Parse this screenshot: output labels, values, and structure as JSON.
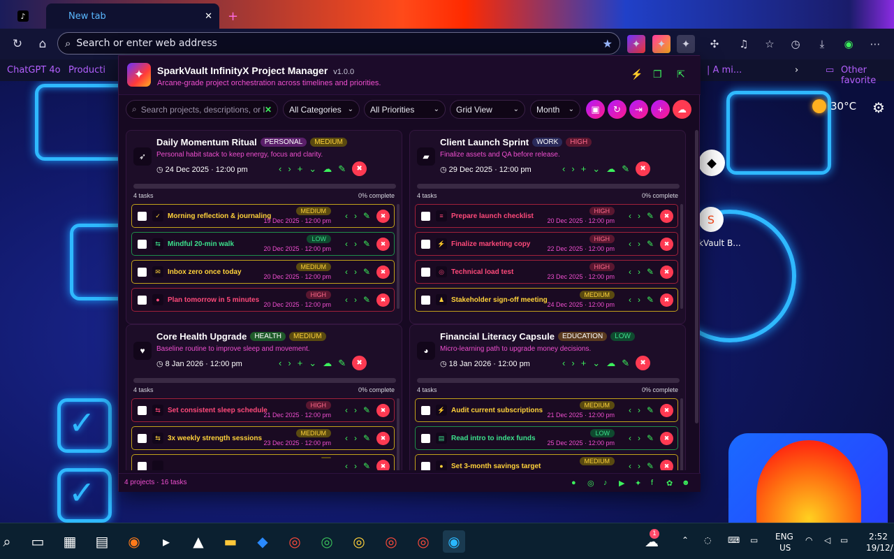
{
  "browser": {
    "tabs": [
      {
        "label": ""
      },
      {
        "label": "New tab"
      }
    ],
    "address_placeholder": "Search or enter web address",
    "favorites": [
      "ChatGPT 4o",
      "Producti",
      "| A mi...",
      "Other favorite"
    ]
  },
  "desktop": {
    "weather_temp": "30°C",
    "icon_label": "kVault B...",
    "taskbar_clock": "2:52",
    "taskbar_date": "19/12/",
    "lang": "ENG",
    "region": "US",
    "notif_count": "1"
  },
  "app": {
    "name": "SparkVault InfinityX Project Manager",
    "version": "v1.0.0",
    "subtitle": "Arcane-grade project orchestration across timelines and priorities.",
    "search_placeholder": "Search projects, descriptions, or la",
    "filters": {
      "category": "All Categories",
      "priority": "All Priorities",
      "view": "Grid View",
      "range": "Month"
    },
    "footer": "4 projects · 16 tasks"
  },
  "projects": [
    {
      "title": "Daily Momentum Ritual",
      "category": "PERSONAL",
      "priority": "MEDIUM",
      "description": "Personal habit stack to keep energy, focus and clarity.",
      "date": "24 Dec 2025 · 12:00 pm",
      "task_count": "4 tasks",
      "completion": "0% complete",
      "icon": "rocket-icon",
      "tasks": [
        {
          "name": "Morning reflection & journaling",
          "priority": "MEDIUM",
          "date": "19 Dec 2025 · 12:00 pm",
          "icon": "✓"
        },
        {
          "name": "Mindful 20-min walk",
          "priority": "LOW",
          "date": "20 Dec 2025 · 12:00 pm",
          "icon": "⇆"
        },
        {
          "name": "Inbox zero once today",
          "priority": "MEDIUM",
          "date": "20 Dec 2025 · 12:00 pm",
          "icon": "✉"
        },
        {
          "name": "Plan tomorrow in 5 minutes",
          "priority": "HIGH",
          "date": "20 Dec 2025 · 12:00 pm",
          "icon": "●"
        }
      ]
    },
    {
      "title": "Client Launch Sprint",
      "category": "WORK",
      "priority": "HIGH",
      "description": "Finalize assets and QA before release.",
      "date": "29 Dec 2025 · 12:00 pm",
      "task_count": "4 tasks",
      "completion": "0% complete",
      "icon": "briefcase-icon",
      "tasks": [
        {
          "name": "Prepare launch checklist",
          "priority": "HIGH",
          "date": "20 Dec 2025 · 12:00 pm",
          "icon": "≡"
        },
        {
          "name": "Finalize marketing copy",
          "priority": "HIGH",
          "date": "22 Dec 2025 · 12:00 pm",
          "icon": "⚡"
        },
        {
          "name": "Technical load test",
          "priority": "HIGH",
          "date": "23 Dec 2025 · 12:00 pm",
          "icon": "◎"
        },
        {
          "name": "Stakeholder sign-off meeting",
          "priority": "MEDIUM",
          "date": "24 Dec 2025 · 12:00 pm",
          "icon": "♟"
        }
      ]
    },
    {
      "title": "Core Health Upgrade",
      "category": "HEALTH",
      "priority": "MEDIUM",
      "description": "Baseline routine to improve sleep and movement.",
      "date": "8 Jan 2026 · 12:00 pm",
      "task_count": "4 tasks",
      "completion": "0% complete",
      "icon": "heart-icon",
      "tasks": [
        {
          "name": "Set consistent sleep schedule",
          "priority": "HIGH",
          "date": "21 Dec 2025 · 12:00 pm",
          "icon": "⇆"
        },
        {
          "name": "3x weekly strength sessions",
          "priority": "MEDIUM",
          "date": "23 Dec 2025 · 12:00 pm",
          "icon": "⇆"
        },
        {
          "name": "",
          "priority": "",
          "date": "",
          "icon": ""
        }
      ]
    },
    {
      "title": "Financial Literacy Capsule",
      "category": "EDUCATION",
      "priority": "LOW",
      "description": "Micro-learning path to upgrade money decisions.",
      "date": "18 Jan 2026 · 12:00 pm",
      "task_count": "4 tasks",
      "completion": "0% complete",
      "icon": "piggy-bank-icon",
      "tasks": [
        {
          "name": "Audit current subscriptions",
          "priority": "MEDIUM",
          "date": "21 Dec 2025 · 12:00 pm",
          "icon": "⚡"
        },
        {
          "name": "Read intro to index funds",
          "priority": "LOW",
          "date": "25 Dec 2025 · 12:00 pm",
          "icon": "▤"
        },
        {
          "name": "Set 3-month savings target",
          "priority": "MEDIUM",
          "date": "",
          "icon": "●"
        }
      ]
    }
  ]
}
